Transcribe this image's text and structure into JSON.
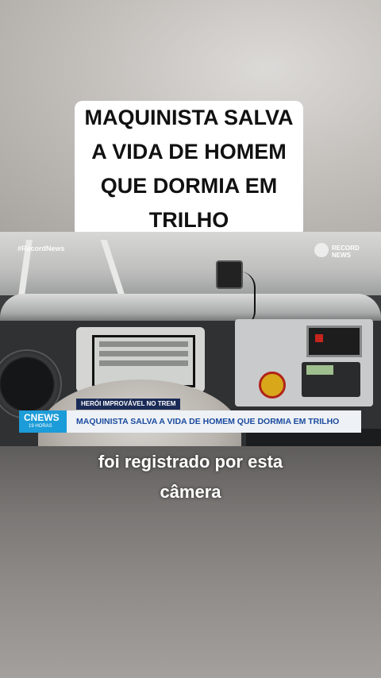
{
  "headline": {
    "lines": [
      "MAQUINISTA SALVA",
      "A VIDA DE HOMEM",
      "QUE DORMIA EM",
      "TRILHO"
    ]
  },
  "video": {
    "watermark": "#RecordNews",
    "channel_logo_text": "RECORD NEWS",
    "lower_third": {
      "kicker": "HERÓI IMPROVÁVEL NO TREM",
      "logo": "CNEWS",
      "logo_sub": "19 HORAS",
      "headline": "MAQUINISTA SALVA A VIDA DE HOMEM QUE DORMIA EM TRILHO"
    }
  },
  "subtitle": {
    "lines": [
      "foi registrado por esta",
      "câmera"
    ]
  },
  "colors": {
    "kicker_bg": "#1b2b57",
    "logo_bg": "#1c9cd8",
    "bar_text": "#1a4a9e"
  }
}
